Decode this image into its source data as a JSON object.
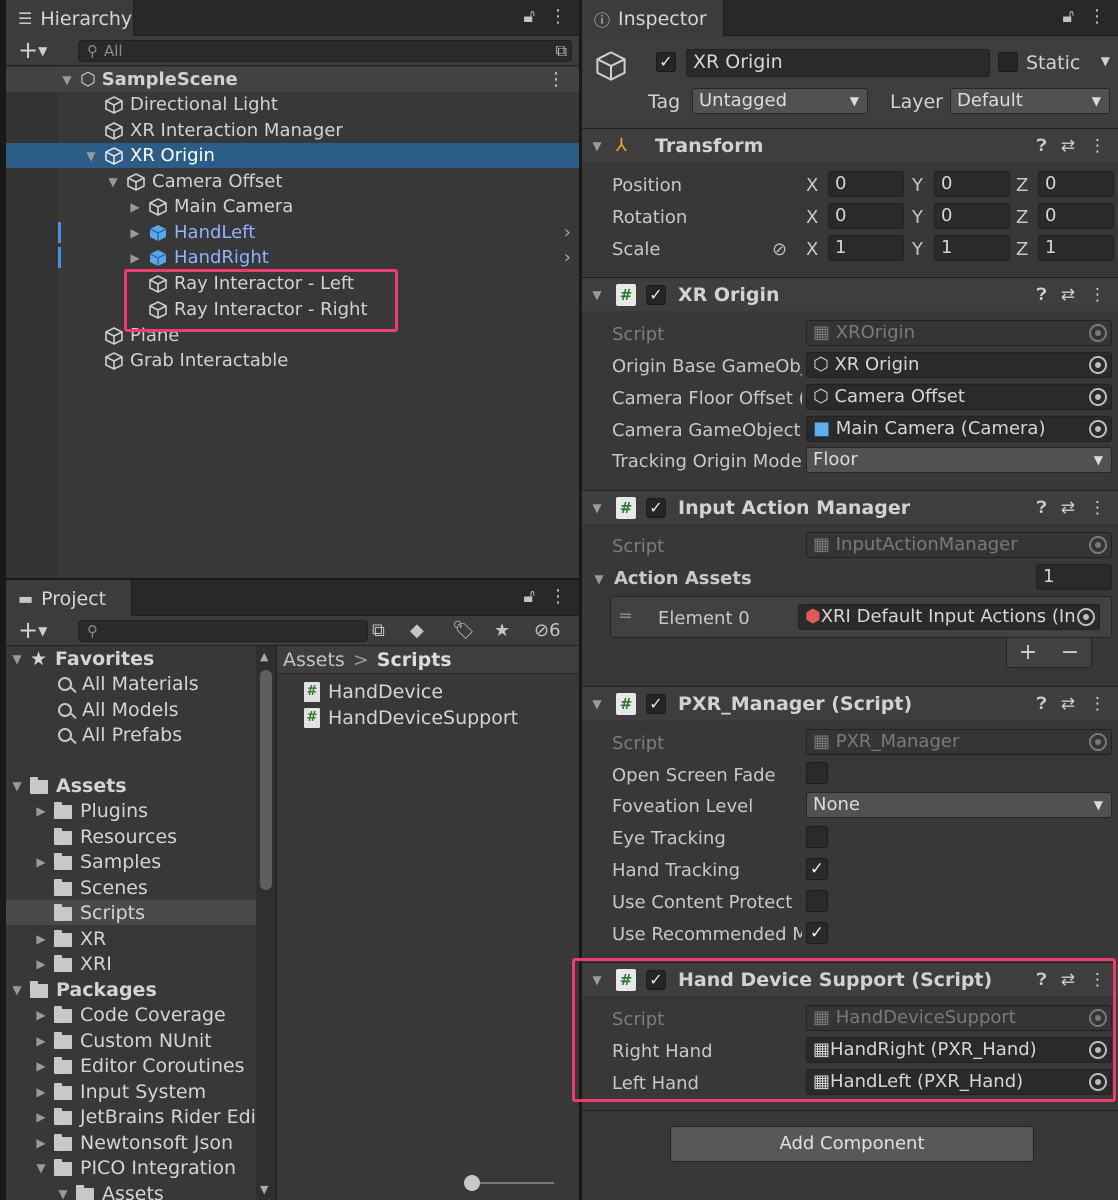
{
  "hierarchy": {
    "tab_label": "Hierarchy",
    "search_placeholder": "All",
    "scene": "SampleScene",
    "items": [
      {
        "label": "Directional Light"
      },
      {
        "label": "XR Interaction Manager"
      },
      {
        "label": "XR Origin"
      },
      {
        "label": "Camera Offset"
      },
      {
        "label": "Main Camera"
      },
      {
        "label": "HandLeft"
      },
      {
        "label": "HandRight"
      },
      {
        "label": "Ray Interactor - Left"
      },
      {
        "label": "Ray Interactor - Right"
      },
      {
        "label": "Plane"
      },
      {
        "label": "Grab Interactable"
      }
    ]
  },
  "project": {
    "tab_label": "Project",
    "hidden_count": "6",
    "breadcrumb": {
      "root": "Assets",
      "sep": ">",
      "current": "Scripts"
    },
    "favorites": {
      "label": "Favorites",
      "items": [
        "All Materials",
        "All Models",
        "All Prefabs"
      ]
    },
    "assets": {
      "label": "Assets",
      "items": [
        "Plugins",
        "Resources",
        "Samples",
        "Scenes",
        "Scripts",
        "XR",
        "XRI"
      ]
    },
    "packages": {
      "label": "Packages",
      "items": [
        "Code Coverage",
        "Custom NUnit",
        "Editor Coroutines",
        "Input System",
        "JetBrains Rider Edi",
        "Newtonsoft Json",
        "PICO Integration",
        "Assets"
      ]
    },
    "files": [
      "HandDevice",
      "HandDeviceSupport"
    ]
  },
  "inspector": {
    "tab_label": "Inspector",
    "object_name": "XR Origin",
    "static_label": "Static",
    "tag_label": "Tag",
    "tag_value": "Untagged",
    "layer_label": "Layer",
    "layer_value": "Default",
    "transform": {
      "title": "Transform",
      "position_label": "Position",
      "rotation_label": "Rotation",
      "scale_label": "Scale",
      "x": "X",
      "y": "Y",
      "z": "Z",
      "position": [
        "0",
        "0",
        "0"
      ],
      "rotation": [
        "0",
        "0",
        "0"
      ],
      "scale": [
        "1",
        "1",
        "1"
      ]
    },
    "xr_origin": {
      "title": "XR Origin",
      "script_label": "Script",
      "script_value": "XROrigin",
      "origin_base_label": "Origin Base GameObj",
      "origin_base_value": "XR Origin",
      "camera_floor_label": "Camera Floor Offset (",
      "camera_floor_value": "Camera Offset",
      "camera_go_label": "Camera GameObject",
      "camera_go_value": "Main Camera (Camera)",
      "tracking_label": "Tracking Origin Mode",
      "tracking_value": "Floor"
    },
    "input_action_manager": {
      "title": "Input Action Manager",
      "script_label": "Script",
      "script_value": "InputActionManager",
      "action_assets_label": "Action Assets",
      "count": "1",
      "element_label": "Element 0",
      "element_value": "XRI Default Input Actions (In",
      "plus": "+",
      "minus": "−"
    },
    "pxr_manager": {
      "title": "PXR_Manager (Script)",
      "script_label": "Script",
      "script_value": "PXR_Manager",
      "open_fade_label": "Open Screen Fade",
      "foveation_label": "Foveation Level",
      "foveation_value": "None",
      "eye_label": "Eye Tracking",
      "hand_label": "Hand Tracking",
      "content_label": "Use Content Protect",
      "recommended_label": "Use Recommended M"
    },
    "hand_device_support": {
      "title": "Hand Device Support (Script)",
      "script_label": "Script",
      "script_value": "HandDeviceSupport",
      "right_label": "Right Hand",
      "right_value": "HandRight (PXR_Hand)",
      "left_label": "Left Hand",
      "left_value": "HandLeft (PXR_Hand)"
    },
    "add_component": "Add Component"
  },
  "colors": {
    "highlight": "#ee3d6d",
    "selection": "#2c5d87",
    "prefab_blue": "#8cb4ff"
  }
}
